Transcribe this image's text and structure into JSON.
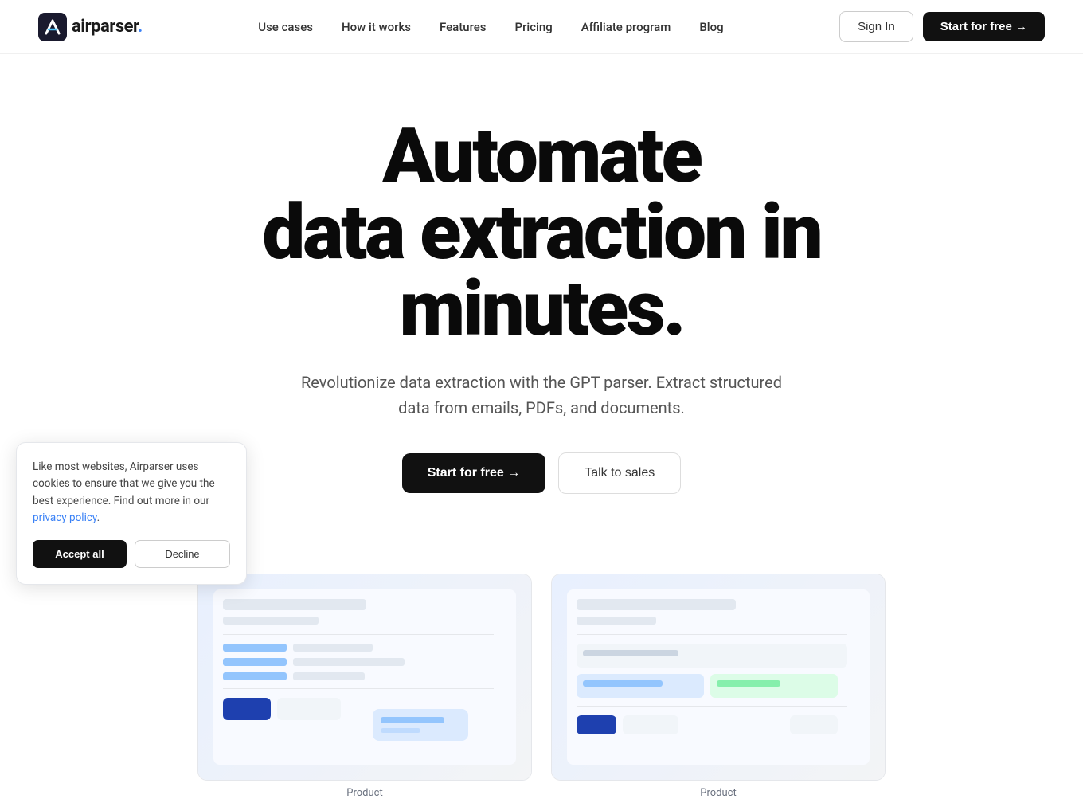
{
  "brand": {
    "name": "airparser",
    "logo_dot": ".",
    "logo_alt": "Airparser logo"
  },
  "navbar": {
    "links": [
      {
        "id": "use-cases",
        "label": "Use cases"
      },
      {
        "id": "how-it-works",
        "label": "How it works"
      },
      {
        "id": "features",
        "label": "Features"
      },
      {
        "id": "pricing",
        "label": "Pricing"
      },
      {
        "id": "affiliate-program",
        "label": "Affiliate program"
      },
      {
        "id": "blog",
        "label": "Blog"
      }
    ],
    "sign_in_label": "Sign In",
    "start_free_label": "Start for free →"
  },
  "hero": {
    "title_line1": "Automate",
    "title_line2": "data extraction in",
    "title_line3": "minutes.",
    "subtitle": "Revolutionize data extraction with the GPT parser. Extract structured data from emails, PDFs, and documents.",
    "cta_start": "Start for free →",
    "cta_sales": "Talk to sales"
  },
  "product_screenshots": [
    {
      "id": "screenshot-1",
      "alt": "Airparser - Data extraction powered by GPT-4 | Product",
      "label": "Product"
    },
    {
      "id": "screenshot-2",
      "alt": "Airparser - Data extraction powered by GPT-4 | Product",
      "label": "Product"
    }
  ],
  "cookie_banner": {
    "text": "Like most websites, Airparser uses cookies to ensure that we give you the best experience. Find out more in our ",
    "link_text": "privacy policy",
    "text_end": ".",
    "accept_label": "Accept all",
    "decline_label": "Decline"
  }
}
